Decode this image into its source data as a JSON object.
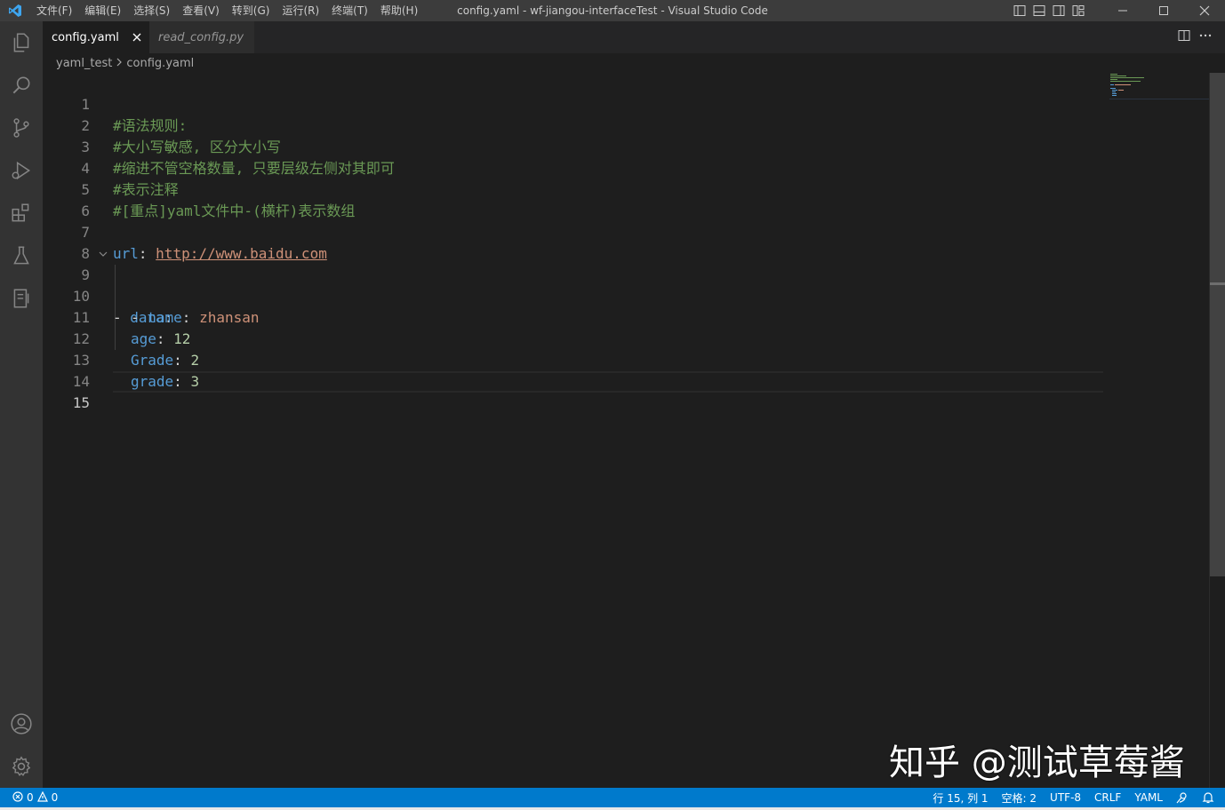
{
  "window": {
    "title": "config.yaml - wf-jiangou-interfaceTest - Visual Studio Code"
  },
  "menu": [
    "文件(F)",
    "编辑(E)",
    "选择(S)",
    "查看(V)",
    "转到(G)",
    "运行(R)",
    "终端(T)",
    "帮助(H)"
  ],
  "activitybar": {
    "items": [
      "explorer-icon",
      "search-icon",
      "source-control-icon",
      "run-debug-icon",
      "extensions-icon",
      "testing-icon",
      "notebook-icon"
    ],
    "bottom": [
      "account-icon",
      "settings-gear-icon"
    ]
  },
  "tabs": [
    {
      "label": "config.yaml",
      "active": true
    },
    {
      "label": "read_config.py",
      "active": false
    }
  ],
  "breadcrumb": {
    "folder": "yaml_test",
    "file": "config.yaml"
  },
  "editor": {
    "current_line": "15",
    "lines": {
      "l1": {
        "n": "1",
        "comment": "#语法规则:"
      },
      "l2": {
        "n": "2",
        "comment": "#大小写敏感, 区分大小写"
      },
      "l3": {
        "n": "3",
        "comment": "#缩进不管空格数量, 只要层级左侧对其即可"
      },
      "l4": {
        "n": "4",
        "comment": "#表示注释"
      },
      "l5": {
        "n": "5",
        "comment": "#[重点]yaml文件中-(横杆)表示数组"
      },
      "l6": {
        "n": "6"
      },
      "l7": {
        "n": "7",
        "key": "url",
        "colon": ": ",
        "value": "http://www.baidu.com"
      },
      "l8": {
        "n": "8"
      },
      "l9": {
        "n": "9",
        "dash": "- ",
        "key": "data",
        "colon": ":"
      },
      "l10": {
        "n": "10",
        "dash": "- ",
        "key": "name",
        "colon": ": ",
        "value": "zhansan"
      },
      "l11": {
        "n": "11",
        "key": "age",
        "colon": ": ",
        "value": "12"
      },
      "l12": {
        "n": "12",
        "key": "Grade",
        "colon": ": ",
        "value": "2"
      },
      "l13": {
        "n": "13",
        "key": "grade",
        "colon": ": ",
        "value": "3"
      },
      "l14": {
        "n": "14"
      },
      "l15": {
        "n": "15"
      }
    }
  },
  "watermark": "知乎 @测试草莓酱",
  "statusbar": {
    "errors": "0",
    "warnings": "0",
    "position": "行 15, 列 1",
    "spaces": "空格: 2",
    "encoding": "UTF-8",
    "eol": "CRLF",
    "language": "YAML"
  },
  "colors": {
    "accent": "#007acc",
    "comment": "#6a9955",
    "key": "#569cd6",
    "string": "#ce9178",
    "number": "#b5cea8"
  }
}
